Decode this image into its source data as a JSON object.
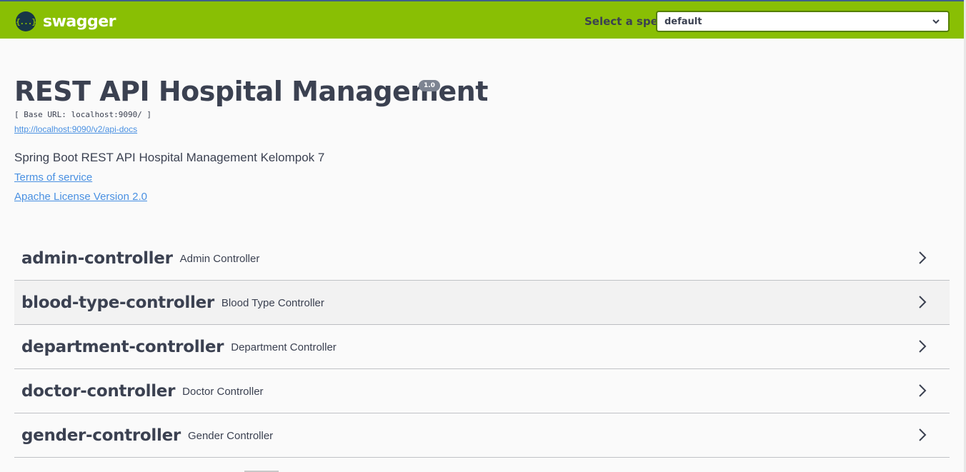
{
  "topbar": {
    "brand_logo_text": "{...}",
    "brand_name": "swagger",
    "spec_label": "Select a spec",
    "spec_selected": "default",
    "colors": {
      "bar": "#89bf04",
      "logo_bg": "#173647"
    }
  },
  "info": {
    "title": "REST API Hospital Management",
    "version": "1.0",
    "base_url": "[ Base URL: localhost:9090/ ]",
    "docs_url": "http://localhost:9090/v2/api-docs",
    "description": "Spring Boot REST API Hospital Management Kelompok 7",
    "terms": "Terms of service",
    "license": "Apache License Version 2.0"
  },
  "tags": [
    {
      "name": "admin-controller",
      "description": "Admin Controller"
    },
    {
      "name": "blood-type-controller",
      "description": "Blood Type Controller"
    },
    {
      "name": "department-controller",
      "description": "Department Controller"
    },
    {
      "name": "doctor-controller",
      "description": "Doctor Controller"
    },
    {
      "name": "gender-controller",
      "description": "Gender Controller"
    }
  ],
  "icons": {
    "spec_dropdown": "chevron-down-icon",
    "tag_expand": "chevron-right-icon"
  }
}
